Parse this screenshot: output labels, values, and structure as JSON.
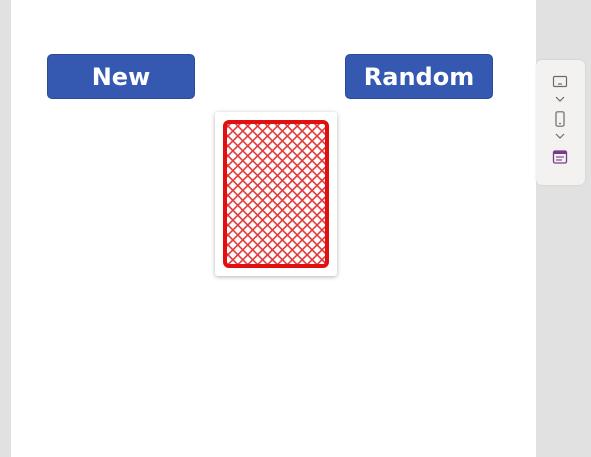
{
  "buttons": {
    "new_label": "New",
    "random_label": "Random"
  },
  "card": {
    "face": "back",
    "back_color": "#e01010"
  },
  "toolbar": {
    "icons": [
      "screen-size-icon",
      "phone-layout-icon",
      "form-icon"
    ]
  },
  "colors": {
    "button_bg": "#3559b0",
    "canvas_bg": "#ffffff",
    "rail_bg": "#e1e1e1",
    "icon_color": "#6b6b6b",
    "accent_icon": "#7a3b8c"
  }
}
